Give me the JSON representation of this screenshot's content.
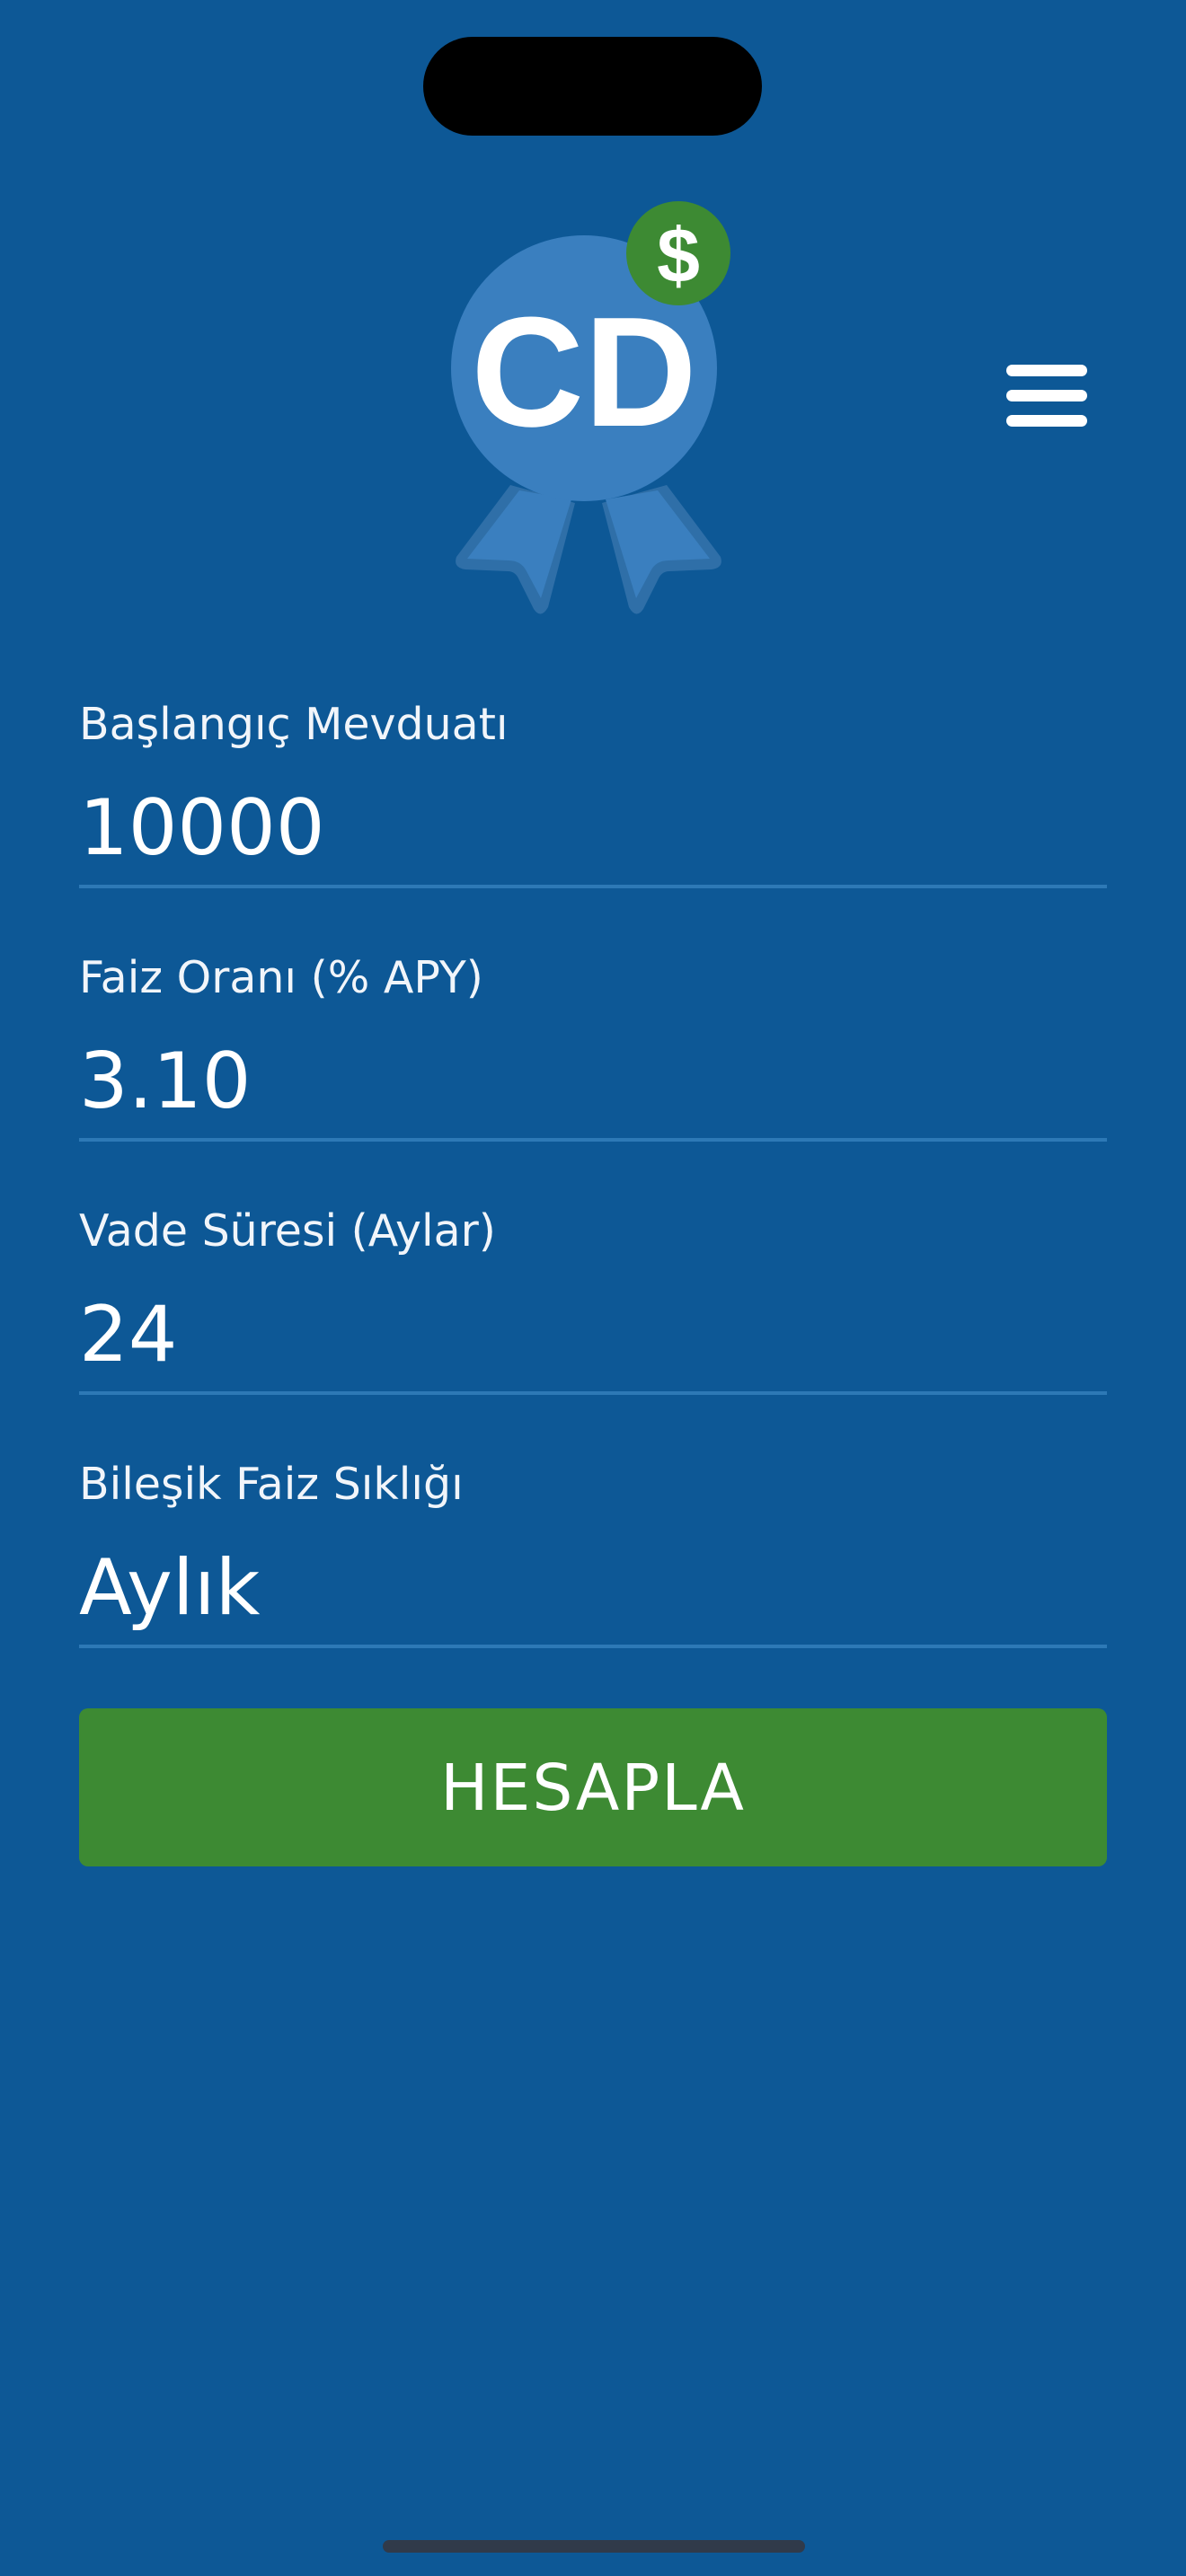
{
  "app": {
    "logo_text": "CD",
    "logo_badge_symbol": "$",
    "menu_icon": "hamburger-menu-icon"
  },
  "form": {
    "initial_deposit": {
      "label": "Başlangıç Mevduatı",
      "value": "10000"
    },
    "interest_rate": {
      "label": "Faiz Oranı (% APY)",
      "value": "3.10"
    },
    "term": {
      "label": "Vade Süresi (Aylar)",
      "value": "24"
    },
    "compounding": {
      "label": "Bileşik Faiz Sıklığı",
      "value": "Aylık"
    }
  },
  "actions": {
    "calculate_label": "HESAPLA"
  },
  "colors": {
    "background": "#0d5896",
    "button": "#3d8a33",
    "badge": "#3d8a33",
    "logo_medal": "#3a7fbf",
    "field_line": "#2d79b6"
  }
}
